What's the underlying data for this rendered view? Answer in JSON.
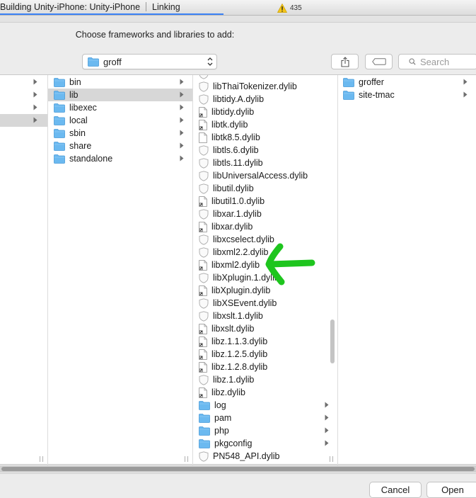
{
  "activity": {
    "title": "Building Unity-iPhone: Unity-iPhone",
    "status": "Linking",
    "warning_count": "435",
    "progress_fraction": 0.47
  },
  "prompt": "Choose frameworks and libraries to add:",
  "location": {
    "label": "groff"
  },
  "search": {
    "placeholder": "Search"
  },
  "columns": {
    "col0": [
      {
        "label": "",
        "has_children": true,
        "selected": false
      },
      {
        "label": "",
        "has_children": true,
        "selected": false
      },
      {
        "label": "",
        "has_children": true,
        "selected": false
      },
      {
        "label": "",
        "has_children": true,
        "selected": true
      }
    ],
    "col1": [
      {
        "label": "bin",
        "icon": "folder-icon",
        "has_children": true,
        "selected": false
      },
      {
        "label": "lib",
        "icon": "folder-icon",
        "has_children": true,
        "selected": true
      },
      {
        "label": "libexec",
        "icon": "folder-icon",
        "has_children": true,
        "selected": false
      },
      {
        "label": "local",
        "icon": "folder-icon",
        "has_children": true,
        "selected": false
      },
      {
        "label": "sbin",
        "icon": "folder-icon",
        "has_children": true,
        "selected": false
      },
      {
        "label": "share",
        "icon": "folder-icon",
        "has_children": true,
        "selected": false
      },
      {
        "label": "standalone",
        "icon": "folder-icon",
        "has_children": true,
        "selected": false
      }
    ],
    "col2": [
      {
        "label": "libThaiTokenizer.dylib",
        "icon": "dylib-icon",
        "has_children": false
      },
      {
        "label": "libtidy.A.dylib",
        "icon": "dylib-icon",
        "has_children": false
      },
      {
        "label": "libtidy.dylib",
        "icon": "alias-file-icon",
        "has_children": false
      },
      {
        "label": "libtk.dylib",
        "icon": "alias-file-icon",
        "has_children": false
      },
      {
        "label": "libtk8.5.dylib",
        "icon": "file-icon",
        "has_children": false
      },
      {
        "label": "libtls.6.dylib",
        "icon": "dylib-icon",
        "has_children": false
      },
      {
        "label": "libtls.11.dylib",
        "icon": "dylib-icon",
        "has_children": false
      },
      {
        "label": "libUniversalAccess.dylib",
        "icon": "dylib-icon",
        "has_children": false
      },
      {
        "label": "libutil.dylib",
        "icon": "dylib-icon",
        "has_children": false
      },
      {
        "label": "libutil1.0.dylib",
        "icon": "alias-file-icon",
        "has_children": false
      },
      {
        "label": "libxar.1.dylib",
        "icon": "dylib-icon",
        "has_children": false
      },
      {
        "label": "libxar.dylib",
        "icon": "alias-file-icon",
        "has_children": false
      },
      {
        "label": "libxcselect.dylib",
        "icon": "dylib-icon",
        "has_children": false
      },
      {
        "label": "libxml2.2.dylib",
        "icon": "dylib-icon",
        "has_children": false
      },
      {
        "label": "libxml2.dylib",
        "icon": "alias-file-icon",
        "has_children": false
      },
      {
        "label": "libXplugin.1.dylib",
        "icon": "dylib-icon",
        "has_children": false
      },
      {
        "label": "libXplugin.dylib",
        "icon": "alias-file-icon",
        "has_children": false
      },
      {
        "label": "libXSEvent.dylib",
        "icon": "dylib-icon",
        "has_children": false
      },
      {
        "label": "libxslt.1.dylib",
        "icon": "dylib-icon",
        "has_children": false
      },
      {
        "label": "libxslt.dylib",
        "icon": "alias-file-icon",
        "has_children": false
      },
      {
        "label": "libz.1.1.3.dylib",
        "icon": "alias-file-icon",
        "has_children": false
      },
      {
        "label": "libz.1.2.5.dylib",
        "icon": "alias-file-icon",
        "has_children": false
      },
      {
        "label": "libz.1.2.8.dylib",
        "icon": "alias-file-icon",
        "has_children": false
      },
      {
        "label": "libz.1.dylib",
        "icon": "dylib-icon",
        "has_children": false
      },
      {
        "label": "libz.dylib",
        "icon": "alias-file-icon",
        "has_children": false
      },
      {
        "label": "log",
        "icon": "folder-icon",
        "has_children": true
      },
      {
        "label": "pam",
        "icon": "folder-icon",
        "has_children": true
      },
      {
        "label": "php",
        "icon": "folder-icon",
        "has_children": true
      },
      {
        "label": "pkgconfig",
        "icon": "folder-icon",
        "has_children": true
      },
      {
        "label": "PN548_API.dylib",
        "icon": "dylib-icon",
        "has_children": false
      }
    ],
    "col3": [
      {
        "label": "groffer",
        "icon": "folder-icon",
        "has_children": true
      },
      {
        "label": "site-tmac",
        "icon": "folder-icon",
        "has_children": true
      }
    ]
  },
  "buttons": {
    "cancel": "Cancel",
    "open": "Open"
  },
  "colors": {
    "folder": "#6bb9f0",
    "annotation": "#1ec51e",
    "progress": "#3b82f6",
    "warning": "#f5c518"
  }
}
